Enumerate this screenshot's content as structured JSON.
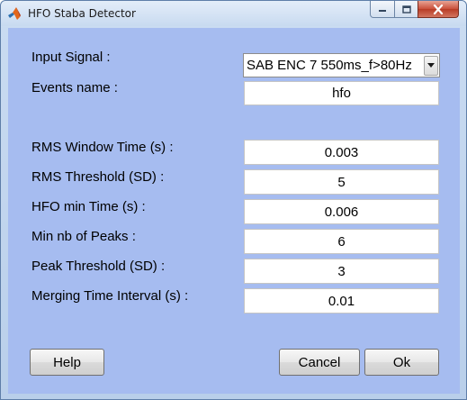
{
  "window": {
    "title": "HFO Staba Detector",
    "icons": {
      "app": "matlab-logo-icon",
      "minimize": "minimize-icon",
      "maximize": "maximize-icon",
      "close": "close-icon"
    }
  },
  "form": {
    "input_signal": {
      "label": "Input Signal :",
      "value": "SAB ENC 7 550ms_f>80Hz",
      "icon": "dropdown-arrow-icon"
    },
    "events_name": {
      "label": "Events name :",
      "value": "hfo"
    },
    "rms_window_time": {
      "label": "RMS Window Time (s) :",
      "value": "0.003"
    },
    "rms_threshold": {
      "label": "RMS Threshold (SD) :",
      "value": "5"
    },
    "hfo_min_time": {
      "label": "HFO min Time (s) :",
      "value": "0.006"
    },
    "min_nb_peaks": {
      "label": "Min nb of Peaks :",
      "value": "6"
    },
    "peak_threshold": {
      "label": "Peak Threshold (SD) :",
      "value": "3"
    },
    "merging_time_interval": {
      "label": "Merging Time Interval (s) :",
      "value": "0.01"
    }
  },
  "buttons": {
    "help": "Help",
    "cancel": "Cancel",
    "ok": "Ok"
  },
  "colors": {
    "client_bg": "#a6bcf0",
    "close_button": "#c9503a"
  }
}
